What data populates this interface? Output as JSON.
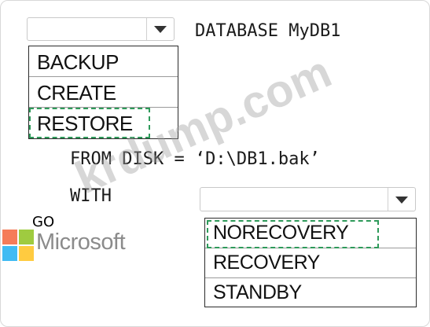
{
  "statement": {
    "database_clause": "DATABASE MyDB1",
    "from_clause": "FROM DISK = ‘D:\\DB1.bak’",
    "with_keyword": "WITH",
    "go_keyword": "GO"
  },
  "dropdown1": {
    "selected": "",
    "options": [
      "BACKUP",
      "CREATE",
      "RESTORE"
    ],
    "highlighted": "RESTORE"
  },
  "dropdown2": {
    "selected": "",
    "options": [
      "NORECOVERY",
      "RECOVERY",
      "STANDBY"
    ],
    "highlighted": "NORECOVERY"
  },
  "branding": {
    "logo_text": "Microsoft",
    "watermark_text": "krdump.com",
    "logo_colors": [
      "#f25022",
      "#7fba00",
      "#00a4ef",
      "#ffb900"
    ],
    "selection_color": "#2e9a5a"
  }
}
